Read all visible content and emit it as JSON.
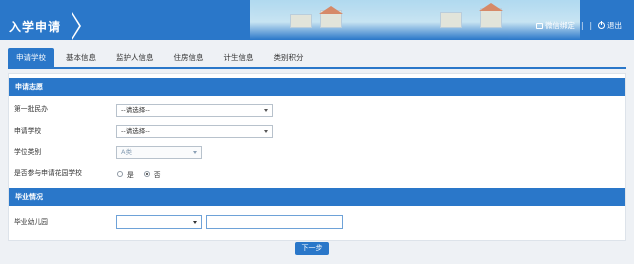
{
  "header": {
    "title": "入学申请",
    "wechat_label": "微信绑定",
    "separator": "|",
    "logout_label": "退出"
  },
  "tabs": [
    {
      "label": "申请学校",
      "active": true
    },
    {
      "label": "基本信息",
      "active": false
    },
    {
      "label": "监护人信息",
      "active": false
    },
    {
      "label": "住房信息",
      "active": false
    },
    {
      "label": "计生信息",
      "active": false
    },
    {
      "label": "类别积分",
      "active": false
    }
  ],
  "sections": {
    "application": {
      "title": "申请志愿",
      "fields": {
        "batch": {
          "label": "第一批民办",
          "value": "--请选择--"
        },
        "school": {
          "label": "申请学校",
          "value": "--请选择--"
        },
        "degree_type": {
          "label": "学位类别",
          "value": "A类"
        },
        "same_school": {
          "label": "是否参与申请花园学校",
          "yes": "是",
          "no": "否",
          "selected": "否"
        }
      }
    },
    "graduation": {
      "title": "毕业情况",
      "fields": {
        "kindergarten": {
          "label": "毕业幼儿园",
          "select_value": "",
          "text_value": ""
        }
      }
    }
  },
  "actions": {
    "next_label": "下一步"
  },
  "colors": {
    "primary": "#2a77c9",
    "background": "#eef1f5"
  }
}
